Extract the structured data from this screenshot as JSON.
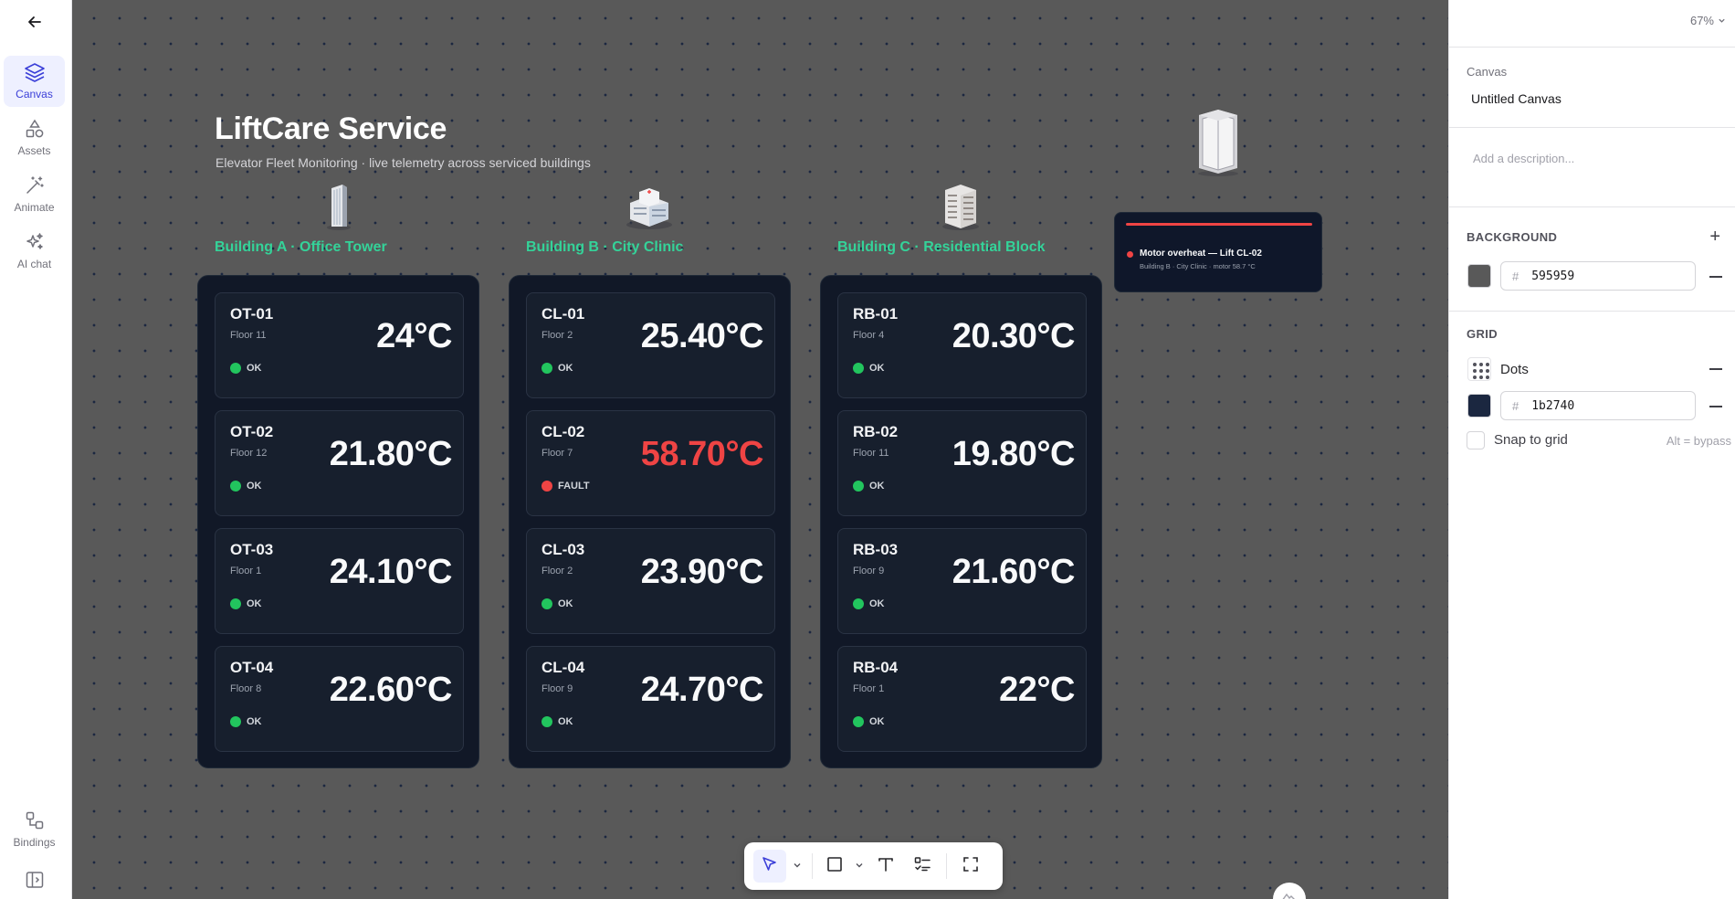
{
  "rail": {
    "items": [
      {
        "label": "Canvas"
      },
      {
        "label": "Assets"
      },
      {
        "label": "Animate"
      },
      {
        "label": "AI chat"
      },
      {
        "label": "Bindings"
      }
    ]
  },
  "canvas": {
    "title": "LiftCare Service",
    "subtitle": "Elevator Fleet Monitoring · live telemetry across serviced buildings",
    "buildings": [
      {
        "label": "Building A · Office Tower",
        "lifts": [
          {
            "id": "OT-01",
            "floor": "Floor 11",
            "temp": "24°C",
            "status": "OK"
          },
          {
            "id": "OT-02",
            "floor": "Floor 12",
            "temp": "21.80°C",
            "status": "OK"
          },
          {
            "id": "OT-03",
            "floor": "Floor 1",
            "temp": "24.10°C",
            "status": "OK"
          },
          {
            "id": "OT-04",
            "floor": "Floor 8",
            "temp": "22.60°C",
            "status": "OK"
          }
        ]
      },
      {
        "label": "Building B · City Clinic",
        "lifts": [
          {
            "id": "CL-01",
            "floor": "Floor 2",
            "temp": "25.40°C",
            "status": "OK"
          },
          {
            "id": "CL-02",
            "floor": "Floor 7",
            "temp": "58.70°C",
            "status": "FAULT"
          },
          {
            "id": "CL-03",
            "floor": "Floor 2",
            "temp": "23.90°C",
            "status": "OK"
          },
          {
            "id": "CL-04",
            "floor": "Floor 9",
            "temp": "24.70°C",
            "status": "OK"
          }
        ]
      },
      {
        "label": "Building C · Residential Block",
        "lifts": [
          {
            "id": "RB-01",
            "floor": "Floor 4",
            "temp": "20.30°C",
            "status": "OK"
          },
          {
            "id": "RB-02",
            "floor": "Floor 11",
            "temp": "19.80°C",
            "status": "OK"
          },
          {
            "id": "RB-03",
            "floor": "Floor 9",
            "temp": "21.60°C",
            "status": "OK"
          },
          {
            "id": "RB-04",
            "floor": "Floor 1",
            "temp": "22°C",
            "status": "OK"
          }
        ]
      }
    ],
    "alert": {
      "title": "Motor overheat — Lift CL-02",
      "description": "Building B · City Clinic · motor 58.7 °C"
    }
  },
  "panel": {
    "zoom": "67%",
    "canvas_label": "Canvas",
    "canvas_name": "Untitled Canvas",
    "description_placeholder": "Add a description...",
    "background_title": "BACKGROUND",
    "background_hash": "#",
    "background_hex": "595959",
    "grid_title": "GRID",
    "grid_type": "Dots",
    "grid_hash": "#",
    "grid_hex": "1b2740",
    "snap_label": "Snap to grid",
    "snap_hint": "Alt = bypass"
  },
  "colors": {
    "canvas_bg": "#595959",
    "grid_dots": "#1b2740",
    "accent": "#3b3fd8",
    "building_label": "#34d399",
    "ok": "#22c55e",
    "fault": "#ef4444"
  }
}
